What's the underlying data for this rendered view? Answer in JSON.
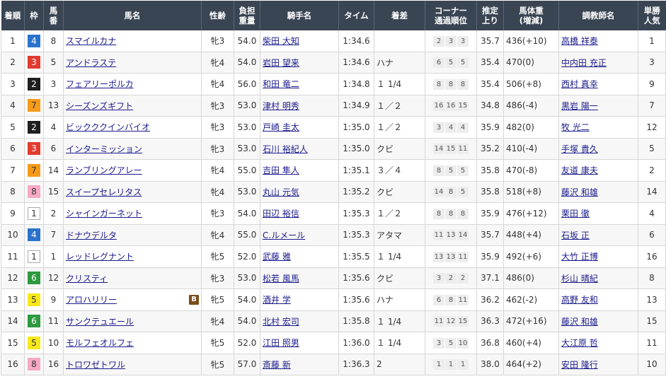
{
  "headers": {
    "place": [
      "着順"
    ],
    "waku": [
      "枠"
    ],
    "num": [
      "馬",
      "番"
    ],
    "horse": [
      "馬名"
    ],
    "sexage": [
      "性齢"
    ],
    "weight": [
      "負担",
      "重量"
    ],
    "jockey": [
      "騎手名"
    ],
    "time": [
      "タイム"
    ],
    "margin": [
      "着差"
    ],
    "corner": [
      "コーナー",
      "通過順位"
    ],
    "last3f": [
      "推定",
      "上り"
    ],
    "bodyweight": [
      "馬体重",
      "(増減)"
    ],
    "trainer": [
      "調教師名"
    ],
    "popularity": [
      "単勝",
      "人気"
    ]
  },
  "blinker_label": "B",
  "rows": [
    {
      "place": "1",
      "waku": "4",
      "num": "8",
      "horse": "スマイルカナ",
      "blinker": false,
      "sexage": "牝3",
      "weight": "54.0",
      "jockey": "柴田 大知",
      "time": "1:34.6",
      "margin": "",
      "corner": [
        "2",
        "3",
        "3"
      ],
      "last3f": "35.7",
      "bodyweight": "436",
      "bwdiff": "(+10)",
      "trainer": "高橋 祥泰",
      "popularity": "1"
    },
    {
      "place": "2",
      "waku": "3",
      "num": "5",
      "horse": "アンドラステ",
      "blinker": false,
      "sexage": "牝4",
      "weight": "54.0",
      "jockey": "岩田 望来",
      "time": "1:34.6",
      "margin": "ハナ",
      "corner": [
        "6",
        "5",
        "5"
      ],
      "last3f": "35.4",
      "bodyweight": "470",
      "bwdiff": "(0)",
      "trainer": "中内田 充正",
      "popularity": "3"
    },
    {
      "place": "3",
      "waku": "2",
      "num": "3",
      "horse": "フェアリーポルカ",
      "blinker": false,
      "sexage": "牝4",
      "weight": "56.0",
      "jockey": "和田 竜二",
      "time": "1:34.8",
      "margin": "１ 1/4",
      "corner": [
        "8",
        "8",
        "8"
      ],
      "last3f": "35.4",
      "bodyweight": "506",
      "bwdiff": "(+8)",
      "trainer": "西村 真幸",
      "popularity": "9"
    },
    {
      "place": "4",
      "waku": "7",
      "num": "13",
      "horse": "シーズンズギフト",
      "blinker": false,
      "sexage": "牝3",
      "weight": "53.0",
      "jockey": "津村 明秀",
      "time": "1:34.9",
      "margin": "１／２",
      "corner": [
        "16",
        "16",
        "15"
      ],
      "last3f": "34.8",
      "bodyweight": "486",
      "bwdiff": "(-4)",
      "trainer": "黒岩 陽一",
      "popularity": "7"
    },
    {
      "place": "5",
      "waku": "2",
      "num": "4",
      "horse": "ビックククインバイオ",
      "blinker": false,
      "sexage": "牝3",
      "weight": "53.0",
      "jockey": "戸崎 圭太",
      "time": "1:35.0",
      "margin": "１／２",
      "corner": [
        "3",
        "4",
        "4"
      ],
      "last3f": "35.9",
      "bodyweight": "482",
      "bwdiff": "(0)",
      "trainer": "牧 光二",
      "popularity": "12"
    },
    {
      "place": "6",
      "waku": "3",
      "num": "6",
      "horse": "インターミッション",
      "blinker": false,
      "sexage": "牝3",
      "weight": "53.0",
      "jockey": "石川 裕紀人",
      "time": "1:35.0",
      "margin": "クビ",
      "corner": [
        "14",
        "15",
        "11"
      ],
      "last3f": "35.2",
      "bodyweight": "410",
      "bwdiff": "(-4)",
      "trainer": "手塚 貴久",
      "popularity": "5"
    },
    {
      "place": "7",
      "waku": "7",
      "num": "14",
      "horse": "ランブリングアレー",
      "blinker": false,
      "sexage": "牝4",
      "weight": "55.0",
      "jockey": "吉田 隼人",
      "time": "1:35.1",
      "margin": "３／４",
      "corner": [
        "8",
        "5",
        "5"
      ],
      "last3f": "35.8",
      "bodyweight": "470",
      "bwdiff": "(-8)",
      "trainer": "友道 康夫",
      "popularity": "2"
    },
    {
      "place": "8",
      "waku": "8",
      "num": "15",
      "horse": "スイープセレリタス",
      "blinker": false,
      "sexage": "牝4",
      "weight": "53.0",
      "jockey": "丸山 元気",
      "time": "1:35.2",
      "margin": "クビ",
      "corner": [
        "14",
        "8",
        "5"
      ],
      "last3f": "35.8",
      "bodyweight": "518",
      "bwdiff": "(+8)",
      "trainer": "藤沢 和雄",
      "popularity": "14"
    },
    {
      "place": "9",
      "waku": "1",
      "num": "2",
      "horse": "シャインガーネット",
      "blinker": false,
      "sexage": "牝3",
      "weight": "54.0",
      "jockey": "田辺 裕信",
      "time": "1:35.3",
      "margin": "１／２",
      "corner": [
        "8",
        "8",
        "8"
      ],
      "last3f": "35.9",
      "bodyweight": "476",
      "bwdiff": "(+12)",
      "trainer": "栗田 徹",
      "popularity": "4"
    },
    {
      "place": "10",
      "waku": "4",
      "num": "7",
      "horse": "ドナウデルタ",
      "blinker": false,
      "sexage": "牝4",
      "weight": "55.0",
      "jockey": "C.ルメール",
      "time": "1:35.3",
      "margin": "アタマ",
      "corner": [
        "11",
        "13",
        "14"
      ],
      "last3f": "35.7",
      "bodyweight": "448",
      "bwdiff": "(+4)",
      "trainer": "石坂 正",
      "popularity": "6"
    },
    {
      "place": "11",
      "waku": "1",
      "num": "1",
      "horse": "レッドレグナント",
      "blinker": false,
      "sexage": "牝5",
      "weight": "52.0",
      "jockey": "武藤 雅",
      "time": "1:35.5",
      "margin": "１ 1/4",
      "corner": [
        "13",
        "13",
        "11"
      ],
      "last3f": "35.9",
      "bodyweight": "492",
      "bwdiff": "(+6)",
      "trainer": "大竹 正博",
      "popularity": "16"
    },
    {
      "place": "12",
      "waku": "6",
      "num": "12",
      "horse": "クリスティ",
      "blinker": false,
      "sexage": "牝3",
      "weight": "53.0",
      "jockey": "松若 風馬",
      "time": "1:35.6",
      "margin": "クビ",
      "corner": [
        "3",
        "2",
        "2"
      ],
      "last3f": "37.1",
      "bodyweight": "486",
      "bwdiff": "(0)",
      "trainer": "杉山 晴紀",
      "popularity": "8"
    },
    {
      "place": "13",
      "waku": "5",
      "num": "9",
      "horse": "アロハリリー",
      "blinker": true,
      "sexage": "牝5",
      "weight": "54.0",
      "jockey": "酒井 学",
      "time": "1:35.6",
      "margin": "ハナ",
      "corner": [
        "6",
        "8",
        "11"
      ],
      "last3f": "36.2",
      "bodyweight": "462",
      "bwdiff": "(-2)",
      "trainer": "高野 友和",
      "popularity": "13"
    },
    {
      "place": "14",
      "waku": "6",
      "num": "11",
      "horse": "サンクテュエール",
      "blinker": false,
      "sexage": "牝4",
      "weight": "54.0",
      "jockey": "北村 宏司",
      "time": "1:35.8",
      "margin": "１ 1/4",
      "corner": [
        "11",
        "12",
        "15"
      ],
      "last3f": "36.3",
      "bodyweight": "472",
      "bwdiff": "(+16)",
      "trainer": "藤沢 和雄",
      "popularity": "15"
    },
    {
      "place": "15",
      "waku": "5",
      "num": "10",
      "horse": "モルフェオルフェ",
      "blinker": false,
      "sexage": "牝5",
      "weight": "52.0",
      "jockey": "江田 照男",
      "time": "1:36.0",
      "margin": "１ 1/4",
      "corner": [
        "3",
        "5",
        "10"
      ],
      "last3f": "36.8",
      "bodyweight": "460",
      "bwdiff": "(+4)",
      "trainer": "大江原 哲",
      "popularity": "11"
    },
    {
      "place": "16",
      "waku": "8",
      "num": "16",
      "horse": "トロワゼトワル",
      "blinker": false,
      "sexage": "牝5",
      "weight": "57.0",
      "jockey": "斎藤 新",
      "time": "1:36.3",
      "margin": "2",
      "corner": [
        "1",
        "1",
        "1"
      ],
      "last3f": "38.0",
      "bodyweight": "464",
      "bwdiff": "(+2)",
      "trainer": "安田 隆行",
      "popularity": "10"
    }
  ]
}
